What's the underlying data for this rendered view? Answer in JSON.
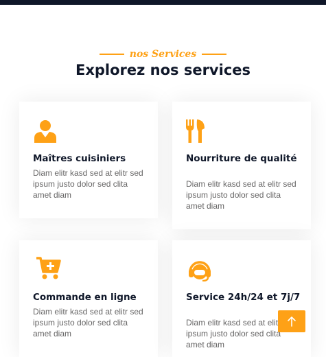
{
  "section": {
    "label": "nos Services",
    "heading": "Explorez nos services"
  },
  "services": [
    {
      "title": "Maîtres cuisiniers",
      "description": "Diam elitr kasd sed at elitr sed ipsum justo dolor sed clita amet diam",
      "icon": "chef-icon"
    },
    {
      "title": "Nourriture de qualité",
      "description": "Diam elitr kasd sed at elitr sed ipsum justo dolor sed clita amet diam",
      "icon": "utensils-icon"
    },
    {
      "title": "Commande en ligne",
      "description": "Diam elitr kasd sed at elitr sed ipsum justo dolor sed clita amet diam",
      "icon": "cart-plus-icon"
    },
    {
      "title": "Service 24h/24 et 7j/7",
      "description": "Diam elitr kasd sed at elitr sed ipsum justo dolor sed clita amet diam",
      "icon": "headset-icon"
    }
  ],
  "colors": {
    "accent": "#FEA116",
    "dark": "#0f1729",
    "text": "#666565"
  },
  "back_to_top": {
    "icon": "arrow-up-icon"
  }
}
